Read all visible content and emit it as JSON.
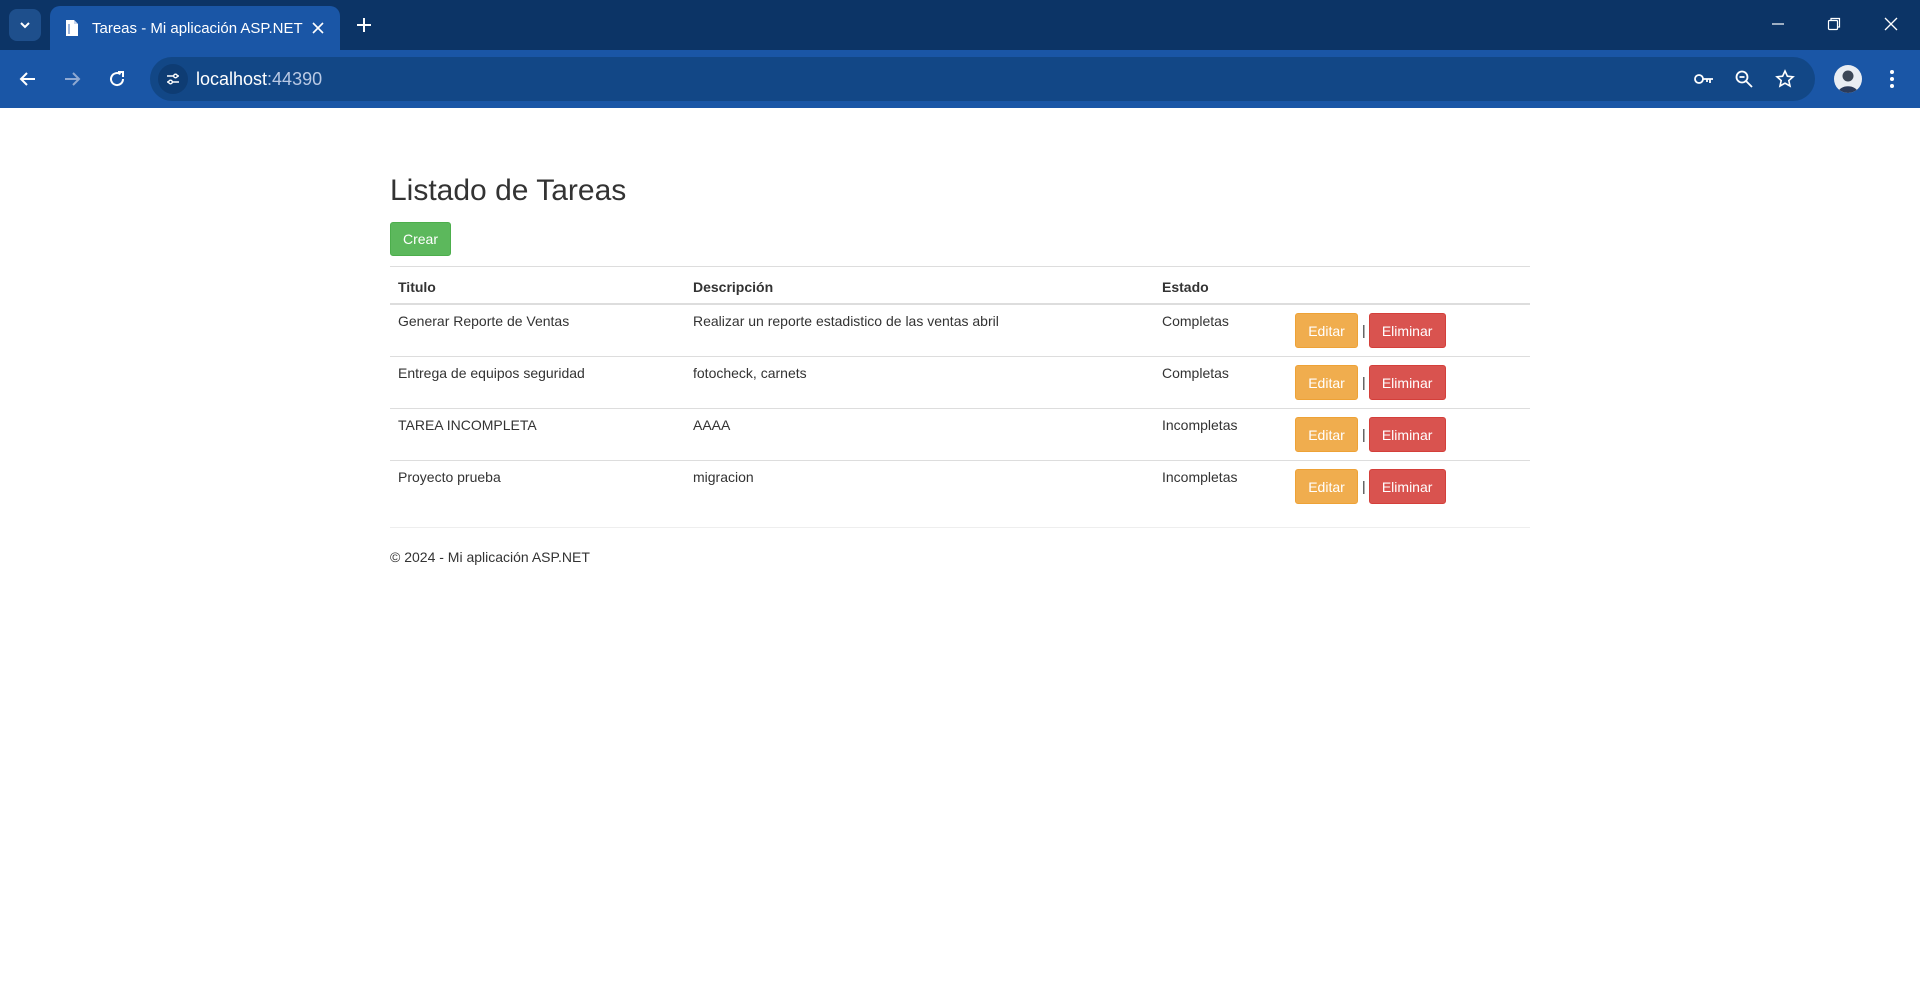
{
  "browser": {
    "tab_title": "Tareas - Mi aplicación ASP.NET",
    "url_host": "localhost",
    "url_port": ":44390",
    "icons": {
      "tab_search": "chevron-down-icon",
      "favicon": "document-icon",
      "tab_close": "close-icon",
      "new_tab": "plus-icon",
      "minimize": "minimize-icon",
      "restore": "restore-icon",
      "close_window": "close-icon",
      "back": "arrow-left-icon",
      "forward": "arrow-right-icon",
      "reload": "reload-icon",
      "site_info": "tune-icon",
      "password": "key-icon",
      "zoom": "zoom-out-icon",
      "bookmark": "star-icon",
      "profile": "avatar",
      "menu": "more-vertical-icon"
    },
    "colors": {
      "tabstrip": "#0c3466",
      "toolbar": "#1a56a6",
      "omnibox": "#124786"
    }
  },
  "page": {
    "heading": "Listado de Tareas",
    "create_button": "Crear",
    "table": {
      "headers": [
        "Titulo",
        "Descripción",
        "Estado",
        ""
      ],
      "rows": [
        {
          "titulo": "Generar Reporte de Ventas",
          "descripcion": "Realizar un reporte estadistico de las ventas abril",
          "estado": "Completas"
        },
        {
          "titulo": "Entrega de equipos seguridad",
          "descripcion": "fotocheck, carnets",
          "estado": "Completas"
        },
        {
          "titulo": "TAREA INCOMPLETA",
          "descripcion": "AAAA",
          "estado": "Incompletas"
        },
        {
          "titulo": "Proyecto prueba",
          "descripcion": "migracion",
          "estado": "Incompletas"
        }
      ],
      "edit_label": "Editar",
      "separator": "|",
      "delete_label": "Eliminar"
    },
    "footer": "© 2024 - Mi aplicación ASP.NET",
    "colors": {
      "success": "#5cb85c",
      "warning": "#f0ad4e",
      "danger": "#d9534f"
    }
  }
}
